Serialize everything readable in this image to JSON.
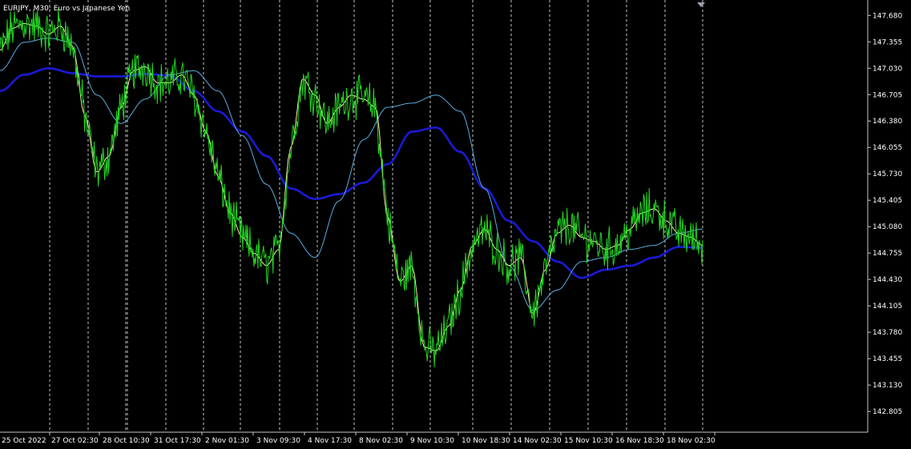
{
  "window": {
    "symbol_title": "EURJPY, M30:  Euro vs Japanese Yen"
  },
  "colors": {
    "background": "#000000",
    "price": "#22d622",
    "ma_fast": "#f5f5a0",
    "ma_medium": "#5aaee0",
    "ma_slow": "#1a1ad8",
    "grid": "#c8c8c8",
    "axis": "#c8c8c8",
    "marker": "#9aa0a8"
  },
  "chart_data": {
    "type": "line",
    "title": "EURJPY, M30:  Euro vs Japanese Yen",
    "ylim": [
      142.55,
      147.87
    ],
    "y_ticks": [
      "147.680",
      "147.355",
      "147.030",
      "146.705",
      "146.380",
      "146.055",
      "145.730",
      "145.405",
      "145.080",
      "144.755",
      "144.430",
      "144.105",
      "143.780",
      "143.455",
      "143.130",
      "142.805"
    ],
    "x_ticks": [
      "25 Oct 2022",
      "27 Oct 02:30",
      "28 Oct 10:30",
      "31 Oct 17:30",
      "2 Nov 01:30",
      "3 Nov 09:30",
      "4 Nov 17:30",
      "8 Nov 02:30",
      "9 Nov 10:30",
      "10 Nov 18:30",
      "14 Nov 02:30",
      "15 Nov 10:30",
      "16 Nov 18:30",
      "18 Nov 02:30"
    ],
    "grid": "vertical dashed",
    "series": [
      {
        "values_x": [
          0,
          0.5,
          1,
          1.5,
          2,
          2.5,
          3,
          3.5,
          4,
          4.5,
          5,
          5.5,
          6,
          6.5,
          7,
          7.5,
          8,
          8.5,
          9,
          9.5,
          10,
          10.5,
          11,
          11.5,
          12,
          12.5,
          13,
          13.5,
          14,
          14.5,
          15
        ],
        "values": [
          147.25,
          147.52,
          147.58,
          147.55,
          147.45,
          147.55,
          147.3,
          146.45,
          145.75,
          145.95,
          146.55,
          147.0,
          147.05,
          146.85,
          146.85,
          146.95,
          146.7,
          146.25,
          145.7,
          145.25,
          144.95,
          144.75,
          144.6,
          144.8,
          146.05,
          146.9,
          146.7,
          146.35,
          146.55,
          146.7,
          146.65
        ]
      },
      {
        "values_x": [
          15,
          15.5,
          16,
          16.5,
          17,
          17.5,
          18,
          18.5,
          19,
          19.5,
          20,
          20.5,
          21,
          21.5,
          22,
          22.5,
          23,
          23.5,
          24,
          24.5,
          25,
          25.5,
          26,
          26.5,
          27,
          27.5,
          28,
          28.5,
          29
        ],
        "values": [
          146.65,
          146.55,
          145.2,
          144.4,
          144.6,
          143.6,
          143.55,
          143.85,
          144.3,
          144.85,
          145.05,
          144.8,
          144.6,
          144.7,
          144.0,
          144.55,
          145.0,
          145.1,
          144.95,
          144.9,
          144.8,
          144.85,
          145.05,
          145.25,
          145.3,
          145.15,
          145.0,
          144.95,
          144.85
        ]
      },
      {
        "values_x": [
          0,
          1,
          2,
          3,
          4,
          5,
          6,
          7,
          8,
          9,
          10,
          11,
          12,
          13,
          14,
          15,
          16,
          17,
          18,
          19,
          20,
          21,
          22,
          23,
          24,
          25,
          26,
          27,
          28,
          29
        ],
        "values": [
          147.0,
          147.35,
          147.4,
          147.35,
          146.7,
          146.35,
          146.65,
          146.95,
          147.0,
          146.75,
          146.2,
          145.6,
          145.0,
          144.7,
          145.4,
          146.15,
          146.55,
          146.6,
          146.7,
          146.5,
          145.55,
          144.6,
          144.05,
          144.3,
          144.65,
          144.7,
          144.8,
          144.85,
          145.0,
          145.05
        ]
      },
      {
        "values_x": [
          0,
          1,
          2,
          3,
          4,
          5,
          6,
          7,
          8,
          9,
          10,
          11,
          12,
          13,
          14,
          15,
          16,
          17,
          18,
          19,
          20,
          21,
          22,
          23,
          24,
          25,
          26,
          27,
          28,
          29
        ],
        "values": [
          146.75,
          146.95,
          147.03,
          146.97,
          146.93,
          146.93,
          146.96,
          146.94,
          146.75,
          146.5,
          146.25,
          145.95,
          145.55,
          145.42,
          145.48,
          145.62,
          145.85,
          146.25,
          146.3,
          146.0,
          145.55,
          145.15,
          144.9,
          144.65,
          144.45,
          144.55,
          144.6,
          144.7,
          144.83,
          144.82
        ]
      }
    ]
  }
}
